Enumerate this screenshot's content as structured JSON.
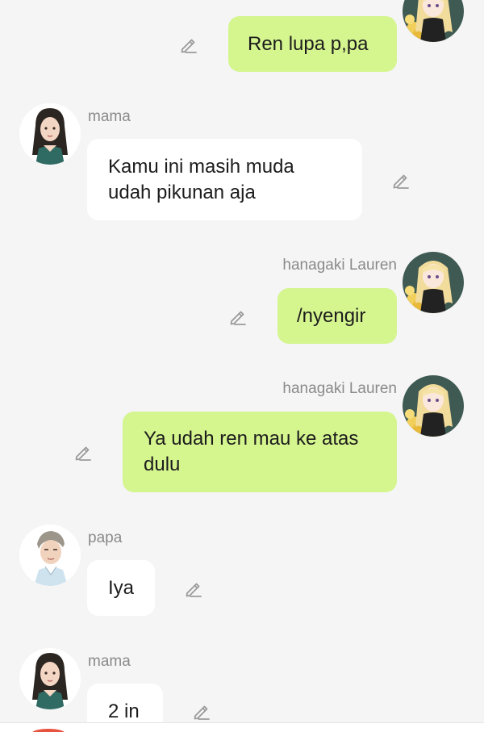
{
  "colors": {
    "background": "#f5f5f5",
    "my_bubble": "#d5f58f",
    "other_bubble": "#ffffff",
    "name_text": "#8a8a8a",
    "edit_icon": "#9a9a9a"
  },
  "users": {
    "lauren": "hanagaki Lauren",
    "mama": "mama",
    "papa": "papa"
  },
  "messages": [
    {
      "sender": "hanagaki Lauren",
      "side": "right",
      "text": "Ren lupa p,pa",
      "icon": "pencil-icon"
    },
    {
      "sender": "mama",
      "side": "left",
      "text": "Kamu ini masih muda udah pikunan aja",
      "icon": "pencil-icon"
    },
    {
      "sender": "hanagaki Lauren",
      "side": "right",
      "text": "/nyengir",
      "icon": "pencil-icon"
    },
    {
      "sender": "hanagaki Lauren",
      "side": "right",
      "text": "Ya udah ren mau ke atas dulu",
      "icon": "pencil-icon"
    },
    {
      "sender": "papa",
      "side": "left",
      "text": "Iya",
      "icon": "pencil-icon"
    },
    {
      "sender": "mama",
      "side": "left",
      "text": "2 in",
      "icon": "pencil-icon"
    }
  ]
}
